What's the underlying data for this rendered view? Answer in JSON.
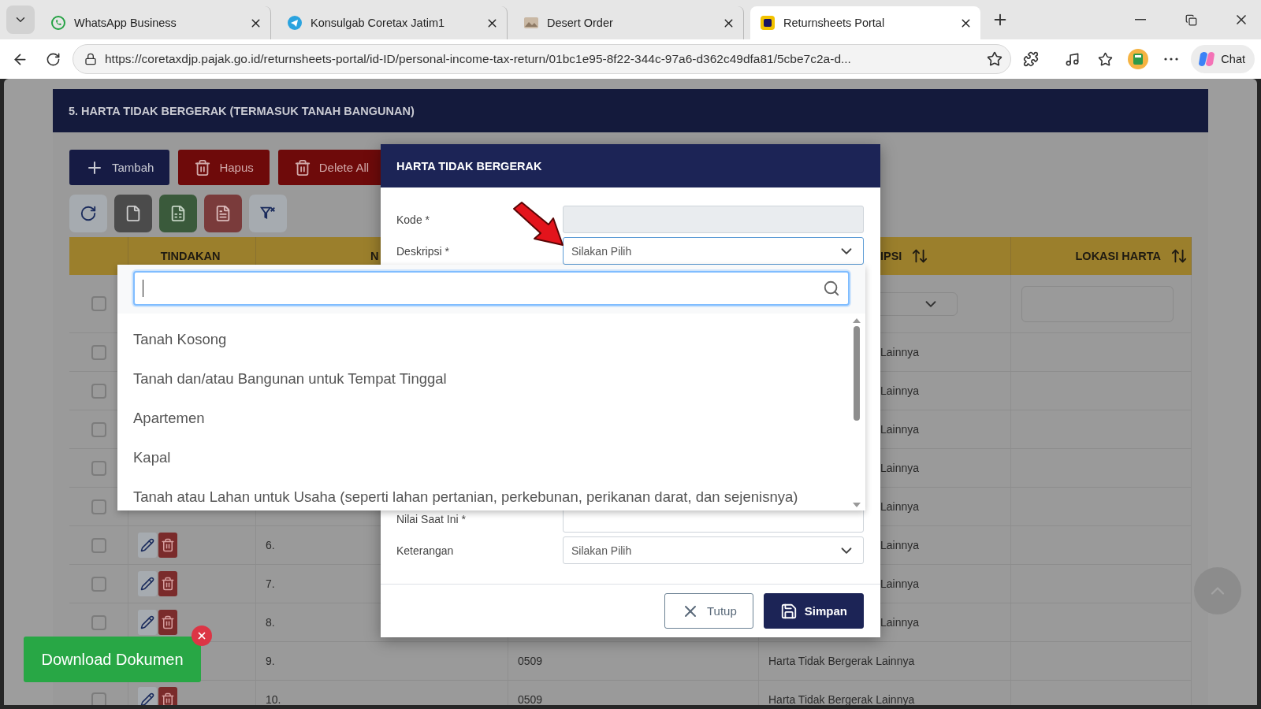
{
  "browser": {
    "tabs": [
      {
        "title": "WhatsApp Business",
        "kind": "whatsapp",
        "selected": false
      },
      {
        "title": "Konsulgab Coretax Jatim1",
        "kind": "telegram",
        "selected": false
      },
      {
        "title": "Desert Order",
        "kind": "image",
        "selected": false
      },
      {
        "title": "Returnsheets Portal",
        "kind": "portal",
        "selected": true
      }
    ],
    "url": "https://coretaxdjp.pajak.go.id/returnsheets-portal/id-ID/personal-income-tax-return/01bc1e95-8f22-344c-97a6-d362c49dfa81/5cbe7c2a-d...",
    "chat_label": "Chat"
  },
  "section": {
    "title": "5. HARTA TIDAK BERGERAK (TERMASUK TANAH BANGUNAN)",
    "actions": [
      {
        "label": "Tambah",
        "kind": "add"
      },
      {
        "label": "Hapus",
        "kind": "delete"
      },
      {
        "label": "Delete All",
        "kind": "delete"
      }
    ],
    "tools": [
      {
        "kind": "refresh"
      },
      {
        "kind": "file"
      },
      {
        "kind": "excel"
      },
      {
        "kind": "pdf"
      },
      {
        "kind": "filter"
      }
    ]
  },
  "table": {
    "select_all_checked": false,
    "columns": [
      {
        "label": "TINDAKAN",
        "sortable": false
      },
      {
        "label": "N"
      },
      {
        "label": "IPSI",
        "sortable": true
      },
      {
        "label": "LOKASI HARTA",
        "sortable": true
      }
    ],
    "rows": [
      {
        "kind": "covered",
        "checked": false,
        "description": "Lainnya"
      },
      {
        "kind": "covered",
        "checked": false,
        "description": "Lainnya"
      },
      {
        "kind": "covered",
        "checked": false,
        "description": "Lainnya"
      },
      {
        "kind": "covered",
        "checked": false,
        "description": "Lainnya"
      },
      {
        "kind": "covered",
        "checked": false,
        "description": "Lainnya"
      },
      {
        "kind": "partial",
        "checked": false,
        "number": "6.",
        "description": "Lainnya"
      },
      {
        "kind": "partial",
        "checked": false,
        "number": "7.",
        "description": "Lainnya"
      },
      {
        "kind": "partial",
        "checked": false,
        "number": "8.",
        "description": "Lainnya"
      },
      {
        "kind": "obscured",
        "number": "9.",
        "code": "0509",
        "description": "Harta Tidak Bergerak Lainnya"
      },
      {
        "kind": "full",
        "checked": false,
        "number": "10.",
        "code": "0509",
        "description": "Harta Tidak Bergerak Lainnya"
      }
    ]
  },
  "modal": {
    "title": "HARTA TIDAK BERGERAK",
    "top_fields": [
      {
        "label": "Kode *",
        "kind": "text",
        "disabled": true,
        "focused": false
      },
      {
        "label": "Deskripsi *",
        "kind": "select",
        "placeholder": "Silakan Pilih",
        "disabled": false,
        "focused": true
      }
    ],
    "bottom_fields": [
      {
        "label": "Nilai Saat Ini *",
        "kind": "text",
        "disabled": false,
        "focused": false
      },
      {
        "label": "Keterangan",
        "kind": "select",
        "placeholder": "Silakan Pilih",
        "disabled": false,
        "focused": false
      }
    ],
    "dropdown": {
      "options": [
        "Tanah Kosong",
        "Tanah dan/atau Bangunan untuk Tempat Tinggal",
        "Apartemen",
        "Kapal",
        "Tanah atau Lahan untuk Usaha (seperti lahan pertanian, perkebunan, perikanan darat, dan sejenisnya)"
      ]
    },
    "buttons": [
      {
        "label": "Tutup",
        "kind": "close"
      },
      {
        "label": "Simpan",
        "kind": "save"
      }
    ]
  },
  "download": {
    "label": "Download Dokumen"
  }
}
